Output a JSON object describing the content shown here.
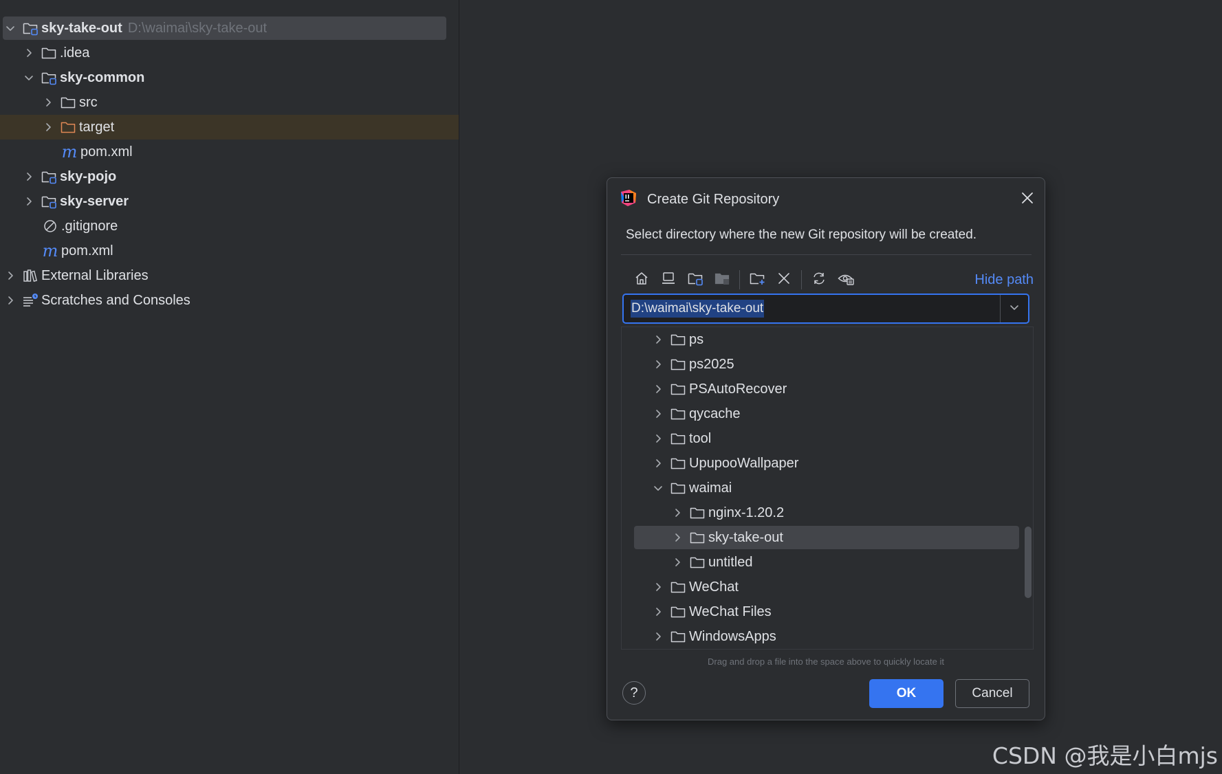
{
  "project_tree": {
    "items": [
      {
        "label": "sky-take-out",
        "path_hint": "D:\\waimai\\sky-take-out"
      },
      {
        "label": ".idea"
      },
      {
        "label": "sky-common"
      },
      {
        "label": "src"
      },
      {
        "label": "target"
      },
      {
        "label": "pom.xml"
      },
      {
        "label": "sky-pojo"
      },
      {
        "label": "sky-server"
      },
      {
        "label": ".gitignore"
      },
      {
        "label": "pom.xml"
      },
      {
        "label": "External Libraries"
      },
      {
        "label": "Scratches and Consoles"
      }
    ],
    "maven_glyph": "m"
  },
  "dialog": {
    "title": "Create Git Repository",
    "description": "Select directory where the new Git repository will be created.",
    "hide_path_label": "Hide path",
    "path_value": "D:\\waimai\\sky-take-out",
    "toolbar_icons": [
      "home-icon",
      "desktop-icon",
      "project-folder-icon",
      "module-folder-icon",
      "new-folder-icon",
      "delete-icon",
      "refresh-icon",
      "show-hidden-icon"
    ],
    "tree": [
      {
        "label": "ps"
      },
      {
        "label": "ps2025"
      },
      {
        "label": "PSAutoRecover"
      },
      {
        "label": "qycache"
      },
      {
        "label": "tool"
      },
      {
        "label": "UpupooWallpaper"
      },
      {
        "label": "waimai"
      },
      {
        "label": "nginx-1.20.2"
      },
      {
        "label": "sky-take-out"
      },
      {
        "label": "untitled"
      },
      {
        "label": "WeChat"
      },
      {
        "label": "WeChat Files"
      },
      {
        "label": "WindowsApps"
      }
    ],
    "drag_hint": "Drag and drop a file into the space above to quickly locate it",
    "help_label": "?",
    "ok_label": "OK",
    "cancel_label": "Cancel"
  },
  "watermark": "CSDN @我是小白mjs",
  "colors": {
    "background": "#2b2d30",
    "accent": "#3574f0",
    "link": "#548af7",
    "selection": "#43454a",
    "target_highlight": "#3c3527",
    "excluded_folder": "#e08855"
  }
}
